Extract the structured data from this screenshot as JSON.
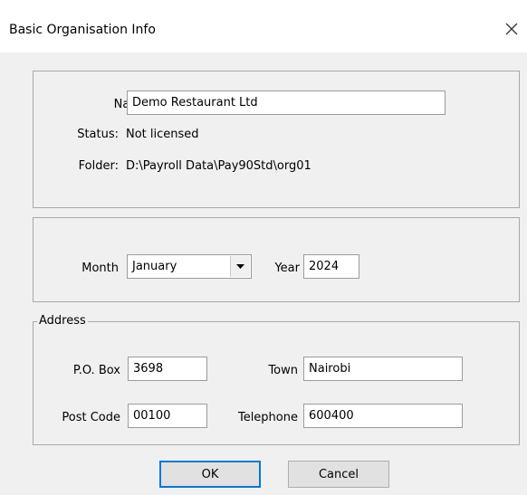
{
  "window": {
    "title": "Basic Organisation Info"
  },
  "org": {
    "name_label": "Name",
    "name_value": "Demo Restaurant Ltd",
    "status_label": "Status:",
    "status_value": "Not licensed",
    "folder_label": "Folder:",
    "folder_value": "D:\\Payroll Data\\Pay90Std\\org01"
  },
  "period": {
    "month_label": "Month",
    "month_value": "January",
    "year_label": "Year",
    "year_value": "2024"
  },
  "address": {
    "legend": "Address",
    "pobox_label": "P.O. Box",
    "pobox_value": "3698",
    "town_label": "Town",
    "town_value": "Nairobi",
    "postcode_label": "Post Code",
    "postcode_value": "00100",
    "telephone_label": "Telephone",
    "telephone_value": "600400"
  },
  "buttons": {
    "ok": "OK",
    "cancel": "Cancel"
  }
}
